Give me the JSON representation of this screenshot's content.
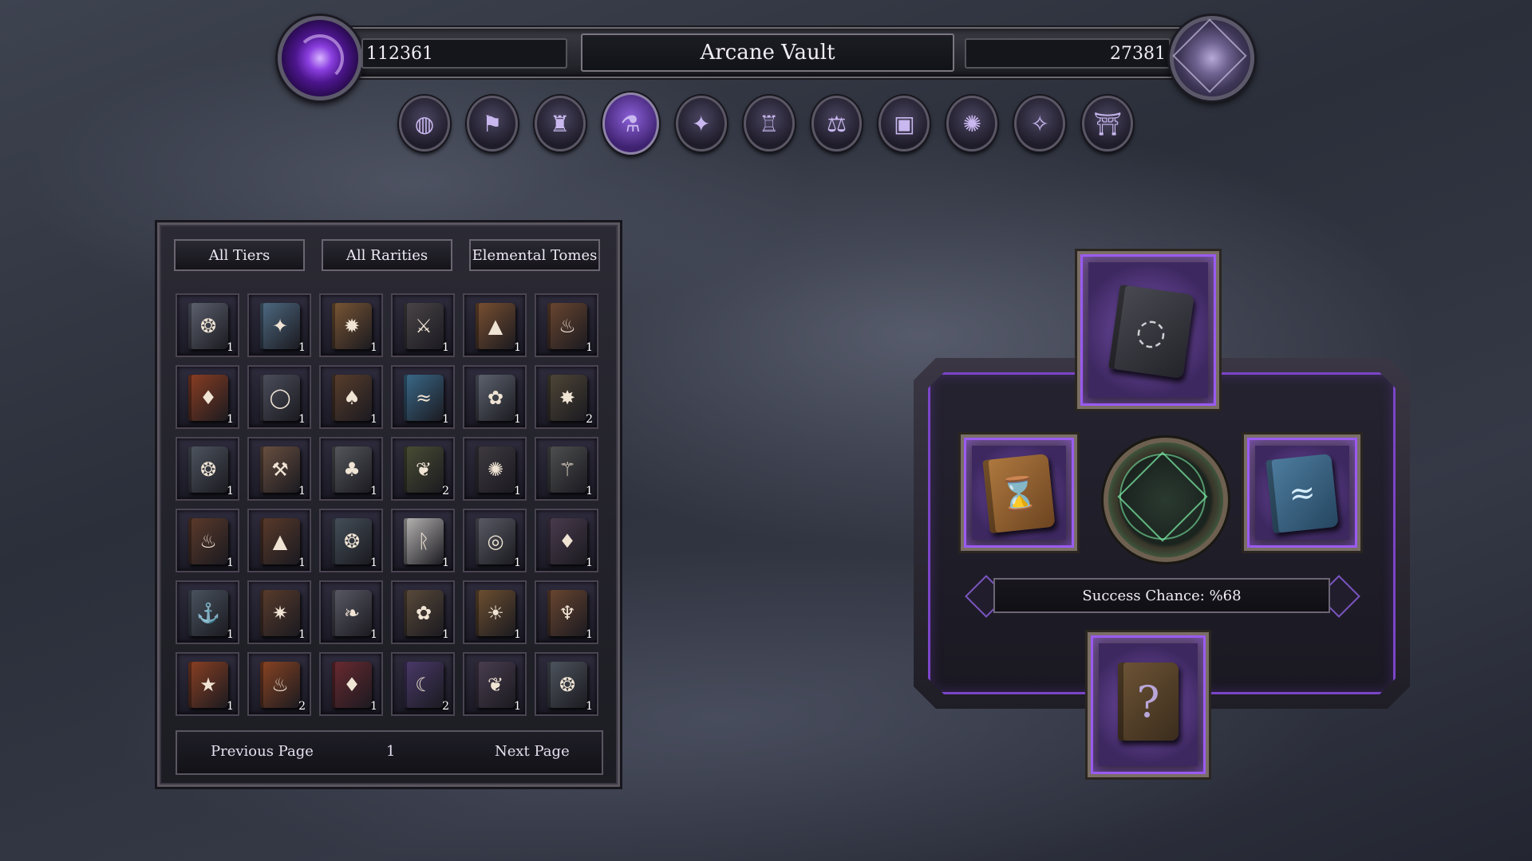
{
  "header": {
    "title": "Arcane Vault",
    "currency_left": "112361",
    "currency_right": "27381",
    "left_orb_icon": "purple-vortex-orb",
    "right_orb_icon": "silver-sigil-orb"
  },
  "nav": {
    "items": [
      {
        "icon": "world-map-icon",
        "glyph": "◍"
      },
      {
        "icon": "guild-banner-icon",
        "glyph": "⚑"
      },
      {
        "icon": "dark-tower-icon",
        "glyph": "♜"
      },
      {
        "icon": "alchemy-potion-icon",
        "glyph": "⚗"
      },
      {
        "icon": "enchanting-table-icon",
        "glyph": "✦"
      },
      {
        "icon": "castle-icon",
        "glyph": "♖"
      },
      {
        "icon": "market-scales-icon",
        "glyph": "⚖"
      },
      {
        "icon": "spellbook-icon",
        "glyph": "▣"
      },
      {
        "icon": "rune-circle-icon",
        "glyph": "✺"
      },
      {
        "icon": "star-crystal-icon",
        "glyph": "✧"
      },
      {
        "icon": "dungeon-gate-icon",
        "glyph": "⛩"
      }
    ],
    "active_index": 3
  },
  "inventory": {
    "filters": [
      "All Tiers",
      "All Rarities",
      "Elemental Tomes"
    ],
    "items": [
      {
        "icon": "wind-tome-icon",
        "glyph": "❂",
        "color": "#5d6270",
        "qty": "1"
      },
      {
        "icon": "frost-shield-tome-icon",
        "glyph": "✦",
        "color": "#4e6a82",
        "qty": "1"
      },
      {
        "icon": "sun-tome-icon",
        "glyph": "✹",
        "color": "#7a5634",
        "qty": "1"
      },
      {
        "icon": "crossed-swords-tome-icon",
        "glyph": "⚔",
        "color": "#4a4548",
        "qty": "1"
      },
      {
        "icon": "volcano-tome-icon",
        "glyph": "▲",
        "color": "#7a5030",
        "qty": "1"
      },
      {
        "icon": "ember-tome-icon",
        "glyph": "♨",
        "color": "#6a4630",
        "qty": "1"
      },
      {
        "icon": "fire-crystal-tome-icon",
        "glyph": "♦",
        "color": "#8a3e22",
        "qty": "1"
      },
      {
        "icon": "void-ring-tome-icon",
        "glyph": "◯",
        "color": "#4c4f5c",
        "qty": "1"
      },
      {
        "icon": "flame-tome-icon",
        "glyph": "♠",
        "color": "#5a3e2c",
        "qty": "1"
      },
      {
        "icon": "water-wave-tome-icon",
        "glyph": "≈",
        "color": "#3a6a8a",
        "qty": "1"
      },
      {
        "icon": "storm-tome-icon",
        "glyph": "✿",
        "color": "#5e6470",
        "qty": "1"
      },
      {
        "icon": "earth-rune-tome-icon",
        "glyph": "✸",
        "color": "#4e4636",
        "qty": "2"
      },
      {
        "icon": "gale-tome-icon",
        "glyph": "❂",
        "color": "#4e5560",
        "qty": "1"
      },
      {
        "icon": "hammer-tome-icon",
        "glyph": "⚒",
        "color": "#6a5040",
        "qty": "1"
      },
      {
        "icon": "dead-tree-tome-icon",
        "glyph": "♣",
        "color": "#55585c",
        "qty": "1"
      },
      {
        "icon": "nature-leaf-tome-icon",
        "glyph": "❦",
        "color": "#4a4e34",
        "qty": "2"
      },
      {
        "icon": "fire-eye-tome-icon",
        "glyph": "✺",
        "color": "#3e3a40",
        "qty": "1"
      },
      {
        "icon": "sword-earth-tome-icon",
        "glyph": "⚚",
        "color": "#4e5050",
        "qty": "1"
      },
      {
        "icon": "blaze-tome-icon",
        "glyph": "♨",
        "color": "#5c3a2a",
        "qty": "1"
      },
      {
        "icon": "magma-tome-icon",
        "glyph": "▲",
        "color": "#5a3a2a",
        "qty": "1"
      },
      {
        "icon": "cyclone-tome-icon",
        "glyph": "❂",
        "color": "#45505a",
        "qty": "1"
      },
      {
        "icon": "rune-r-tome-icon",
        "glyph": "ᚱ",
        "color": "#b8b6b4",
        "qty": "1"
      },
      {
        "icon": "tornado-tome-icon",
        "glyph": "◎",
        "color": "#5a5c66",
        "qty": "1"
      },
      {
        "icon": "shadow-crystal-tome-icon",
        "glyph": "♦",
        "color": "#4a3c4e",
        "qty": "1"
      },
      {
        "icon": "anchor-tome-icon",
        "glyph": "⚓",
        "color": "#4a5460",
        "qty": "1"
      },
      {
        "icon": "eruption-tome-icon",
        "glyph": "✷",
        "color": "#5a3c2c",
        "qty": "1"
      },
      {
        "icon": "feather-tome-icon",
        "glyph": "❧",
        "color": "#5a5a66",
        "qty": "1"
      },
      {
        "icon": "vortex-tome-icon",
        "glyph": "✿",
        "color": "#5a4a3a",
        "qty": "1"
      },
      {
        "icon": "radiant-sun-tome-icon",
        "glyph": "☀",
        "color": "#6e5030",
        "qty": "1"
      },
      {
        "icon": "flame-mark-tome-icon",
        "glyph": "♆",
        "color": "#6a4630",
        "qty": "1"
      },
      {
        "icon": "phoenix-star-tome-icon",
        "glyph": "★",
        "color": "#8a4022",
        "qty": "1"
      },
      {
        "icon": "inferno-tome-icon",
        "glyph": "♨",
        "color": "#8a4422",
        "qty": "2"
      },
      {
        "icon": "blood-crystal-tome-icon",
        "glyph": "♦",
        "color": "#6a2a30",
        "qty": "1"
      },
      {
        "icon": "moon-tome-icon",
        "glyph": "☾",
        "color": "#4a3a6a",
        "qty": "2"
      },
      {
        "icon": "sprout-tome-icon",
        "glyph": "❦",
        "color": "#4a3e50",
        "qty": "1"
      },
      {
        "icon": "spiral-wind-tome-icon",
        "glyph": "❂",
        "color": "#4e555e",
        "qty": "1"
      }
    ],
    "pagination": {
      "previous_label": "Previous Page",
      "current_page": "1",
      "next_label": "Next Page"
    }
  },
  "crafting": {
    "top_slot": {
      "icon": "dark-rune-tome-icon",
      "glyph": "◌"
    },
    "left_slot": {
      "icon": "hourglass-tome-icon",
      "glyph": "⌛"
    },
    "right_slot": {
      "icon": "wave-tome-icon",
      "glyph": "≈"
    },
    "center_icon": "arcane-sigil-circle-icon",
    "result_slot": {
      "icon": "mystery-tome-icon",
      "glyph": "?"
    },
    "success_chance_label": "Success Chance: %68"
  }
}
